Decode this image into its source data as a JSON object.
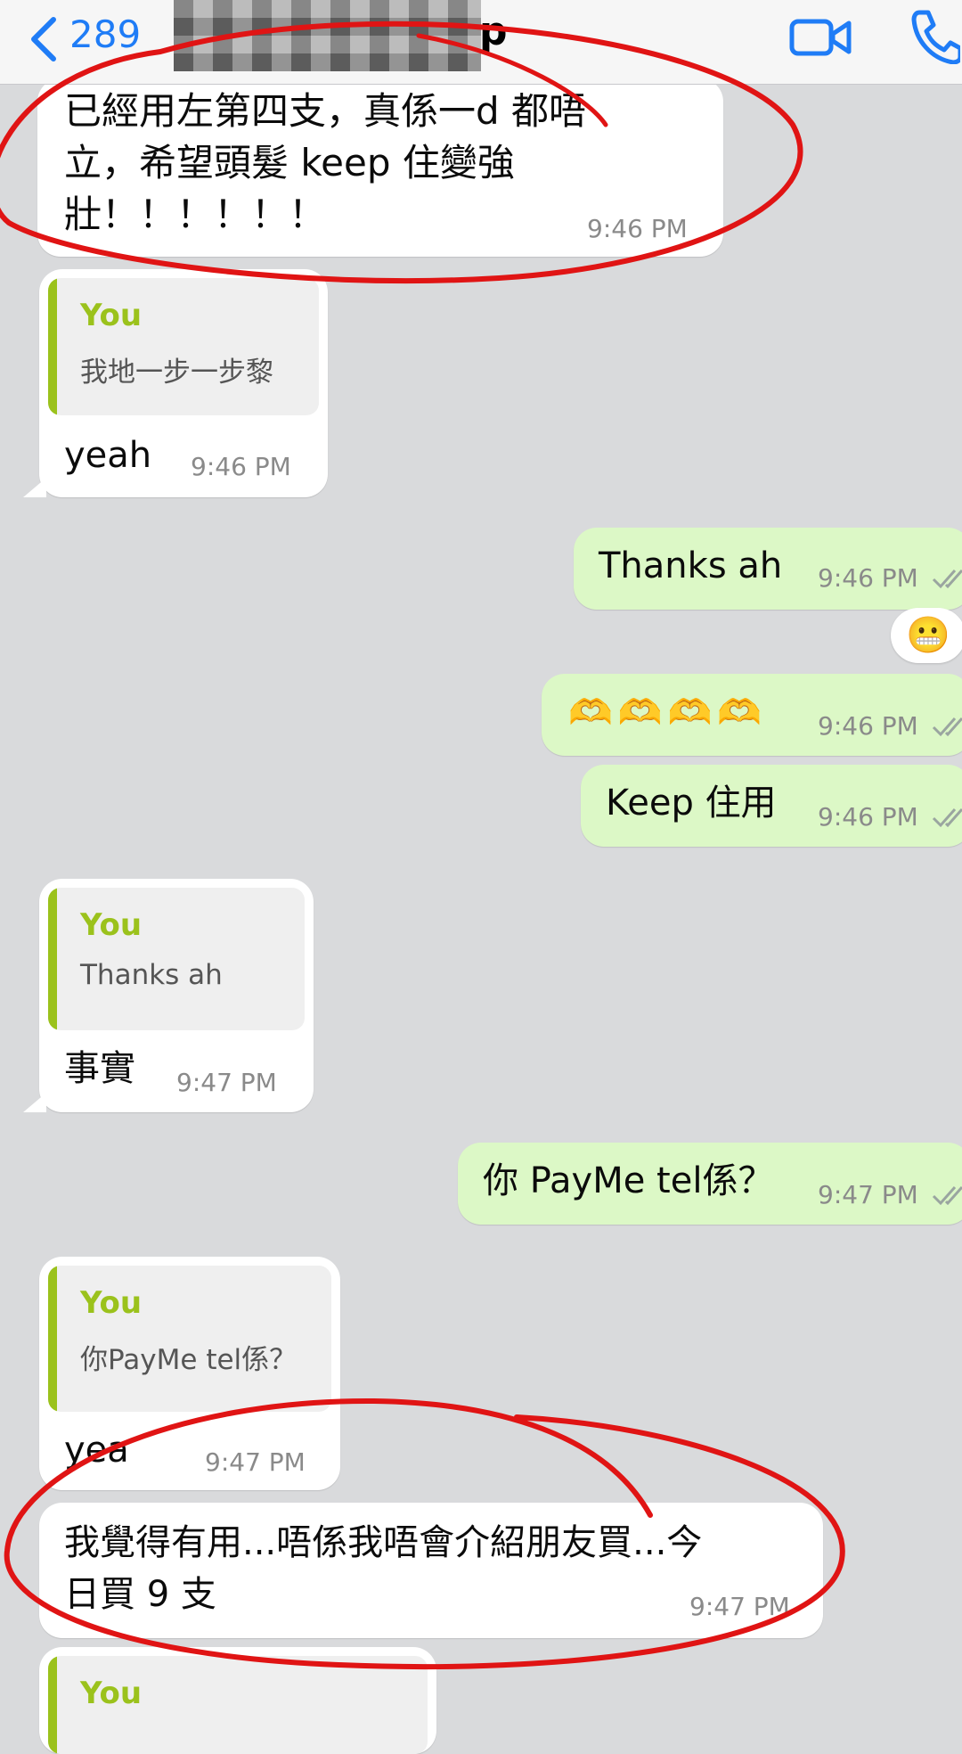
{
  "header": {
    "back_count": "289",
    "name_tail": "p",
    "back_icon": "chevron-left-icon",
    "video_icon": "video-camera-icon",
    "call_icon": "phone-icon"
  },
  "messages": {
    "m1": {
      "text": "已經用左第四支，真係一d 都唔\n立，希望頭髮 keep 住變強\n壯！！！！！！",
      "time": "9:46 PM"
    },
    "m2": {
      "quote_name": "You",
      "quote_text": "我地一步一步黎",
      "text": "yeah",
      "time": "9:46 PM"
    },
    "m3": {
      "text": "Thanks ah",
      "time": "9:46 PM",
      "reaction": "😬"
    },
    "m4": {
      "text": "🫶🫶🫶🫶",
      "time": "9:46 PM"
    },
    "m5": {
      "text": "Keep 住用",
      "time": "9:46 PM"
    },
    "m6": {
      "quote_name": "You",
      "quote_text": "Thanks ah",
      "text": "事實",
      "time": "9:47 PM"
    },
    "m7": {
      "text": "你 PayMe tel係？",
      "time": "9:47 PM"
    },
    "m8": {
      "quote_name": "You",
      "quote_text": "你PayMe tel係？",
      "text": "yea",
      "time": "9:47 PM"
    },
    "m9": {
      "text": "我覺得有用...唔係我唔會介紹朋友買...今\n日買 9 支",
      "time": "9:47 PM"
    },
    "m10": {
      "quote_name": "You"
    }
  },
  "colors": {
    "background": "#d9dadc",
    "incoming": "#ffffff",
    "outgoing": "#dcf8c6",
    "quote_accent": "#9bc21c",
    "ios_blue": "#1f7cf6",
    "annotation_red": "#e01414"
  }
}
